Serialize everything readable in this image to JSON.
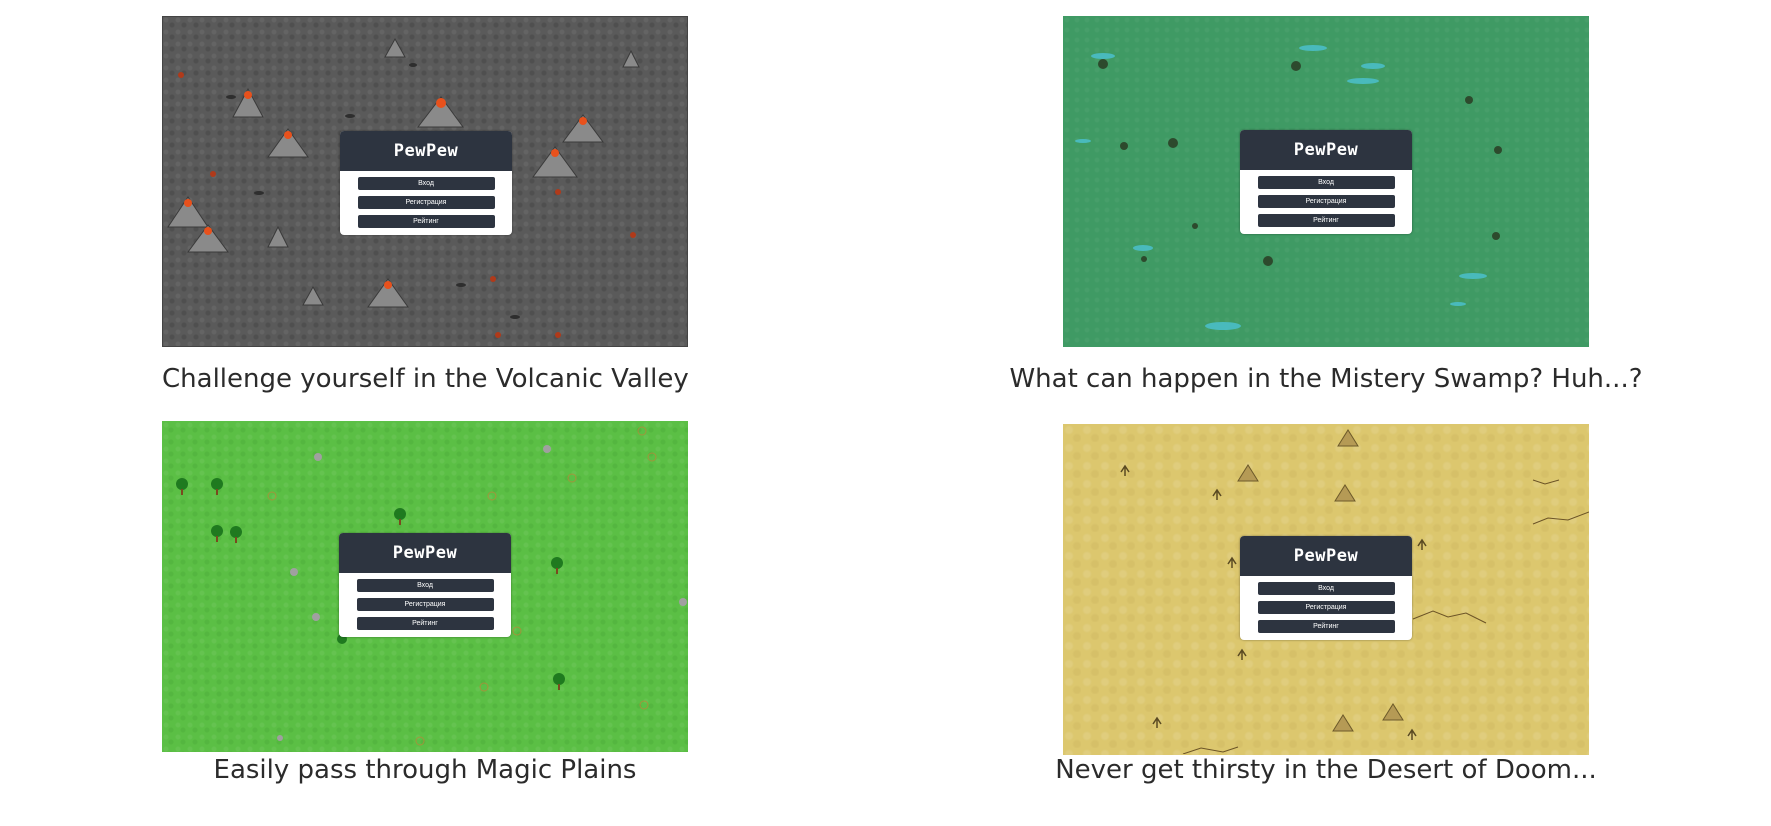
{
  "menu": {
    "game_title": "PewPew",
    "login_label": "Вход",
    "register_label": "Регистрация",
    "rating_label": "Рейтинг"
  },
  "scenes": [
    {
      "theme": "volcanic",
      "caption": "Challenge yourself in the Volcanic Valley",
      "ground_color": "#5a5a5a"
    },
    {
      "theme": "swamp",
      "caption": "What can happen in the Mistery Swamp? Huh...?",
      "ground_color": "#3f9a64"
    },
    {
      "theme": "plains",
      "caption": "Easily pass through Magic Plains",
      "ground_color": "#5bbf45"
    },
    {
      "theme": "desert",
      "caption": "Never get thirsty in the Desert of Doom...",
      "ground_color": "#dcc76e"
    }
  ],
  "colors": {
    "panel_header": "#2d3440",
    "panel_body": "#ffffff",
    "lava": "#e8511c"
  }
}
